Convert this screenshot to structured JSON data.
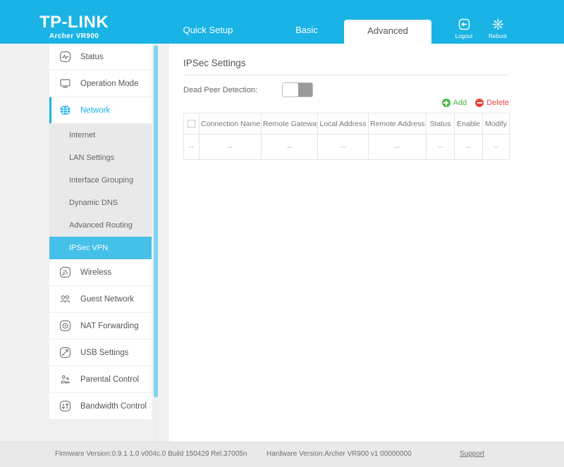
{
  "header": {
    "brand": "TP-LINK",
    "model": "Archer VR900",
    "tabs": [
      {
        "label": "Quick Setup",
        "active": false
      },
      {
        "label": "Basic",
        "active": false
      },
      {
        "label": "Advanced",
        "active": true
      }
    ],
    "actions": [
      {
        "label": "Logout",
        "icon": "logout-icon"
      },
      {
        "label": "Reboot",
        "icon": "reboot-icon"
      }
    ],
    "bg_color": "#19b3e6"
  },
  "sidebar": {
    "items": [
      {
        "label": "Status",
        "icon": "status-icon",
        "selected": false
      },
      {
        "label": "Operation Mode",
        "icon": "monitor-icon",
        "selected": false
      },
      {
        "label": "Network",
        "icon": "globe-icon",
        "selected": true
      },
      {
        "label": "Wireless",
        "icon": "wireless-icon",
        "selected": false
      },
      {
        "label": "Guest Network",
        "icon": "guest-network-icon",
        "selected": false
      },
      {
        "label": "NAT Forwarding",
        "icon": "nat-forwarding-icon",
        "selected": false
      },
      {
        "label": "USB Settings",
        "icon": "usb-icon",
        "selected": false
      },
      {
        "label": "Parental Control",
        "icon": "parental-control-icon",
        "selected": false
      },
      {
        "label": "Bandwidth Control",
        "icon": "bandwidth-control-icon",
        "selected": false
      }
    ],
    "submenu": [
      {
        "label": "Internet",
        "active": false
      },
      {
        "label": "LAN Settings",
        "active": false
      },
      {
        "label": "Interface Grouping",
        "active": false
      },
      {
        "label": "Dynamic DNS",
        "active": false
      },
      {
        "label": "Advanced Routing",
        "active": false
      },
      {
        "label": "IPSec VPN",
        "active": true
      }
    ],
    "active_color": "#45c0e8"
  },
  "content": {
    "title": "IPSec Settings",
    "dead_peer_detection": {
      "label": "Dead Peer Detection:",
      "state": "off"
    },
    "actions": {
      "add_label": "Add",
      "add_color": "#4cb749",
      "delete_label": "Delete",
      "delete_color": "#e8453c"
    },
    "table": {
      "columns": [
        "",
        "Connection Name",
        "Remote Gateway",
        "Local Address",
        "Remote Address",
        "Status",
        "Enable",
        "Modify"
      ],
      "rows": [
        [
          "--",
          "--",
          "--",
          "--",
          "--",
          "--",
          "--",
          "--"
        ]
      ]
    }
  },
  "footer": {
    "firmware": "Firmware Version:0.9.1 1.0 v004c.0 Build 150429 Rel.37005n",
    "hardware": "Hardware Version:Archer VR900 v1 00000000",
    "support": "Support"
  }
}
